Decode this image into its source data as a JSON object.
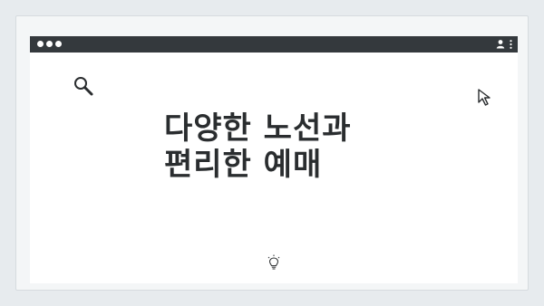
{
  "page": {
    "headline_line1": "다양한 노선과",
    "headline_line2": "편리한 예매"
  },
  "icons": {
    "search": "search-icon",
    "cursor": "cursor-arrow-icon",
    "idea": "lightbulb-icon",
    "user": "user-icon",
    "menu": "kebab-menu-icon"
  },
  "colors": {
    "background": "#e7ebee",
    "titlebar": "#34393d",
    "text": "#2a2d2f"
  }
}
